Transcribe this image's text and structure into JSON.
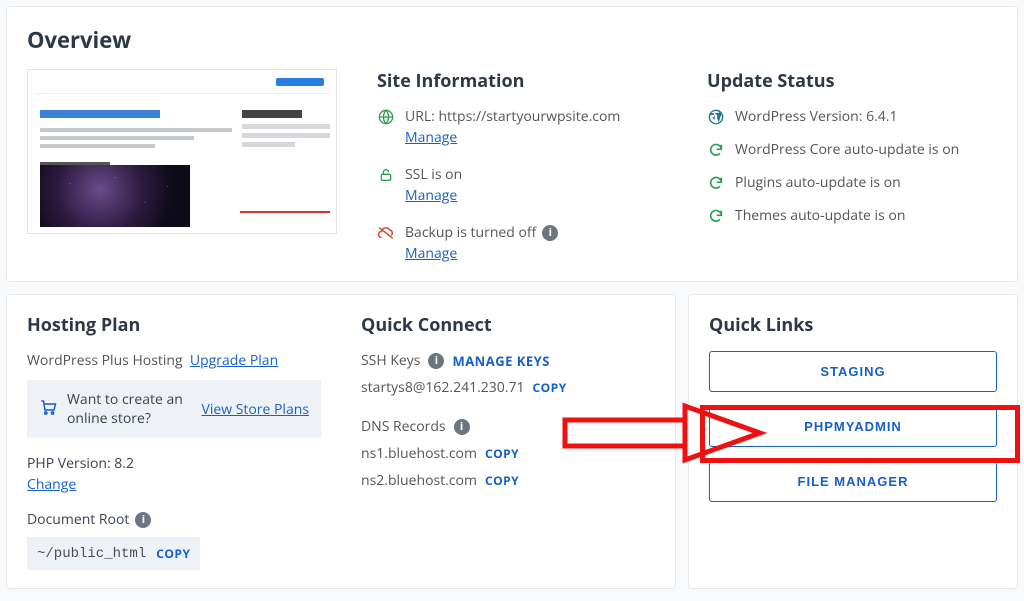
{
  "overview": {
    "heading": "Overview",
    "site_info": {
      "heading": "Site Information",
      "url_label": "URL: https://startyourwpsite.com",
      "url_manage": "Manage",
      "ssl_label": "SSL is on",
      "ssl_manage": "Manage",
      "backup_label": "Backup is turned off",
      "backup_manage": "Manage"
    },
    "update_status": {
      "heading": "Update Status",
      "wp_version": "WordPress Version: 6.4.1",
      "core": "WordPress Core auto-update is on",
      "plugins": "Plugins auto-update is on",
      "themes": "Themes auto-update is on"
    }
  },
  "hosting": {
    "heading": "Hosting Plan",
    "plan_name": "WordPress Plus Hosting",
    "upgrade": "Upgrade Plan",
    "store_prompt": "Want to create an online store?",
    "store_plans": "View Store Plans",
    "php_label": "PHP Version: 8.2",
    "php_change": "Change",
    "docroot_label": "Document Root",
    "docroot_value": "~/public_html",
    "docroot_copy": "COPY"
  },
  "quick_connect": {
    "heading": "Quick Connect",
    "ssh_label": "SSH Keys",
    "manage_keys": "MANAGE KEYS",
    "ssh_value": "startys8@162.241.230.71",
    "ssh_copy": "COPY",
    "dns_label": "DNS Records",
    "ns1": "ns1.bluehost.com",
    "ns1_copy": "COPY",
    "ns2": "ns2.bluehost.com",
    "ns2_copy": "COPY"
  },
  "quick_links": {
    "heading": "Quick Links",
    "staging": "STAGING",
    "phpmyadmin": "PHPMYADMIN",
    "file_manager": "FILE MANAGER"
  }
}
